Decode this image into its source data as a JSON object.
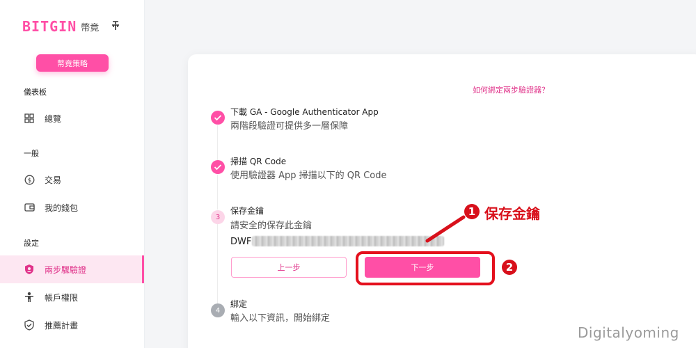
{
  "sidebar": {
    "logo": "BITGIN",
    "logo_sub": "幣竟",
    "strategy_button": "幣竟策略",
    "sections": {
      "dashboard": "儀表板",
      "general": "一般",
      "settings": "設定"
    },
    "items": [
      {
        "label": "總覽",
        "icon": "grid-icon"
      },
      {
        "label": "交易",
        "icon": "dollar-circle-icon"
      },
      {
        "label": "我的錢包",
        "icon": "wallet-icon"
      },
      {
        "label": "兩步驟驗證",
        "icon": "shield-icon",
        "active": true
      },
      {
        "label": "帳戶權限",
        "icon": "person-icon"
      },
      {
        "label": "推薦計畫",
        "icon": "shield-check-icon"
      }
    ]
  },
  "main": {
    "help_link": "如何綁定兩步驗證器？",
    "steps": [
      {
        "number": "",
        "status": "done",
        "title": "下載 GA - Google Authenticator App",
        "desc": "兩階段驗證可提供多一層保障"
      },
      {
        "number": "",
        "status": "done",
        "title": "掃描 QR Code",
        "desc": "使用驗證器 App 掃描以下的 QR Code"
      },
      {
        "number": "3",
        "status": "current",
        "title": "保存金鑰",
        "desc": "請安全的保存此金鑰"
      },
      {
        "number": "4",
        "status": "pending",
        "title": "綁定",
        "desc": "輸入以下資訊，開始綁定"
      }
    ],
    "key_prefix": "DWF",
    "prev_button": "上一步",
    "next_button": "下一步"
  },
  "annotations": {
    "badge1": "1",
    "badge1_text": "保存金鑰",
    "badge2": "2"
  },
  "watermark": "Digitalyoming",
  "colors": {
    "accent": "#ff4fa6",
    "accent_dark": "#e0338a",
    "annotation_red": "#d8101b"
  }
}
